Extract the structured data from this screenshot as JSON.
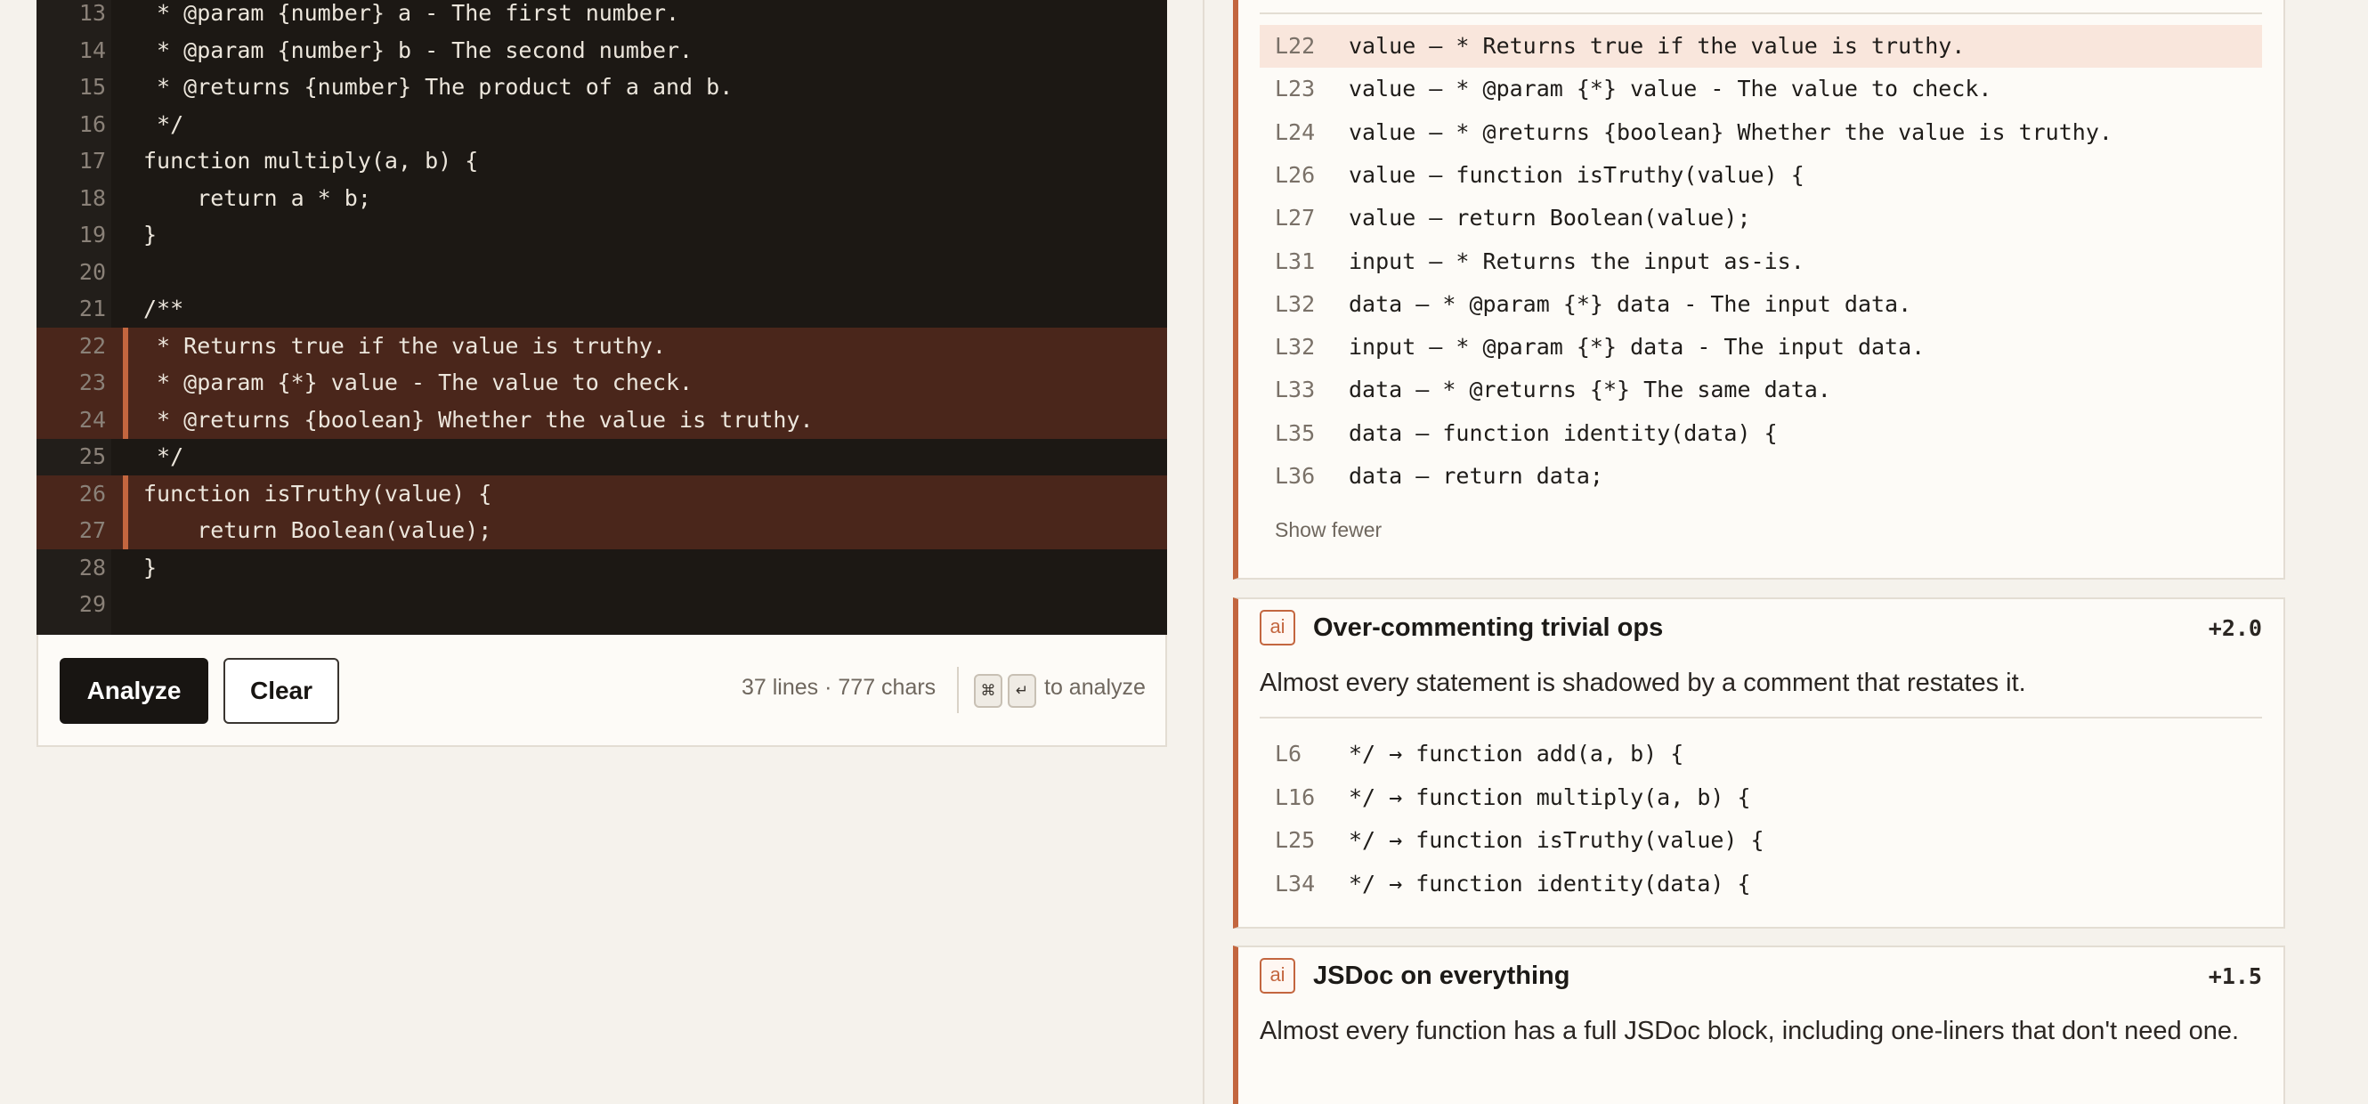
{
  "editor": {
    "lines": [
      {
        "n": "13",
        "text": " * @param {number} a - The first number.",
        "hl": false
      },
      {
        "n": "14",
        "text": " * @param {number} b - The second number.",
        "hl": false
      },
      {
        "n": "15",
        "text": " * @returns {number} The product of a and b.",
        "hl": false
      },
      {
        "n": "16",
        "text": " */",
        "hl": false
      },
      {
        "n": "17",
        "text": "function multiply(a, b) {",
        "hl": false
      },
      {
        "n": "18",
        "text": "    return a * b;",
        "hl": false
      },
      {
        "n": "19",
        "text": "}",
        "hl": false
      },
      {
        "n": "20",
        "text": "",
        "hl": false
      },
      {
        "n": "21",
        "text": "/**",
        "hl": false
      },
      {
        "n": "22",
        "text": " * Returns true if the value is truthy.",
        "hl": true
      },
      {
        "n": "23",
        "text": " * @param {*} value - The value to check.",
        "hl": true
      },
      {
        "n": "24",
        "text": " * @returns {boolean} Whether the value is truthy.",
        "hl": true
      },
      {
        "n": "25",
        "text": " */",
        "hl": false
      },
      {
        "n": "26",
        "text": "function isTruthy(value) {",
        "hl": true
      },
      {
        "n": "27",
        "text": "    return Boolean(value);",
        "hl": true
      },
      {
        "n": "28",
        "text": "}",
        "hl": false
      },
      {
        "n": "29",
        "text": "",
        "hl": false
      }
    ]
  },
  "toolbar": {
    "analyze_label": "Analyze",
    "clear_label": "Clear",
    "stats": "37 lines · 777 chars",
    "key1": "⌘",
    "key2": "↵",
    "hint": "to analyze"
  },
  "findings": [
    {
      "rows": [
        {
          "line": "L22",
          "text": "value — * Returns true if the value is truthy.",
          "hl": true
        },
        {
          "line": "L23",
          "text": "value — * @param {*} value - The value to check.",
          "hl": false
        },
        {
          "line": "L24",
          "text": "value — * @returns {boolean} Whether the value is truthy.",
          "hl": false
        },
        {
          "line": "L26",
          "text": "value — function isTruthy(value) {",
          "hl": false
        },
        {
          "line": "L27",
          "text": "value — return Boolean(value);",
          "hl": false
        },
        {
          "line": "L31",
          "text": "input — * Returns the input as-is.",
          "hl": false
        },
        {
          "line": "L32",
          "text": "data — * @param {*} data - The input data.",
          "hl": false
        },
        {
          "line": "L32",
          "text": "input — * @param {*} data - The input data.",
          "hl": false
        },
        {
          "line": "L33",
          "text": "data — * @returns {*} The same data.",
          "hl": false
        },
        {
          "line": "L35",
          "text": "data — function identity(data) {",
          "hl": false
        },
        {
          "line": "L36",
          "text": "data — return data;",
          "hl": false
        }
      ],
      "show_fewer": "Show fewer"
    },
    {
      "badge": "ai",
      "title": "Over-commenting trivial ops",
      "score": "+2.0",
      "description": "Almost every statement is shadowed by a comment that restates it.",
      "rows": [
        {
          "line": "L6",
          "text": "*/ → function add(a, b) {"
        },
        {
          "line": "L16",
          "text": "*/ → function multiply(a, b) {"
        },
        {
          "line": "L25",
          "text": "*/ → function isTruthy(value) {"
        },
        {
          "line": "L34",
          "text": "*/ → function identity(data) {"
        }
      ]
    },
    {
      "badge": "ai",
      "title": "JSDoc on everything",
      "score": "+1.5",
      "description": "Almost every function has a full JSDoc block, including one-liners that don't need one."
    }
  ],
  "colors": {
    "accent": "#c3663f",
    "editor_bg": "#1c1814",
    "highlight_line": "#4a261b",
    "highlight_row": "#f9e6dc"
  }
}
